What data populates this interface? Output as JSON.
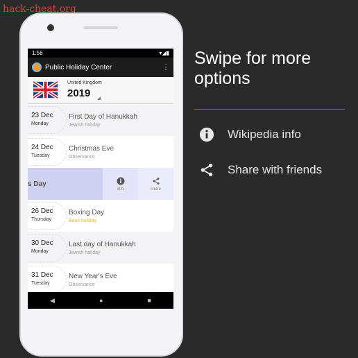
{
  "watermark": "hack-cheat.org",
  "status": {
    "time": "1:56"
  },
  "app": {
    "title": "Public Holiday Center"
  },
  "header": {
    "country": "United Kingdom",
    "year": "2019"
  },
  "rows": [
    {
      "day": "23 Dec",
      "weekday": "Monday",
      "name": "First Day of Hanukkah",
      "kind": "Jewish holiday"
    },
    {
      "day": "24 Dec",
      "weekday": "Tuesday",
      "name": "Christmas Eve",
      "kind": "Observance"
    },
    {
      "day": "26 Dec",
      "weekday": "Thursday",
      "name": "Boxing Day",
      "kind": "Bank holiday"
    },
    {
      "day": "30 Dec",
      "weekday": "Monday",
      "name": "Last day of Hanukkah",
      "kind": "Jewish holiday"
    },
    {
      "day": "31 Dec",
      "weekday": "Tuesday",
      "name": "New Year's Eve",
      "kind": "Observance"
    }
  ],
  "swiped": {
    "partial_name": "s Day",
    "info_label": "info",
    "share_label": "share"
  },
  "promo": {
    "title": "Swipe for more options",
    "options": [
      {
        "icon": "info-icon",
        "label": "Wikipedia info"
      },
      {
        "icon": "share-icon",
        "label": "Share with friends"
      }
    ]
  },
  "colors": {
    "swipe": "#d0d1f1",
    "accent_line": "#7d6f45",
    "bank": "#e8b820"
  }
}
